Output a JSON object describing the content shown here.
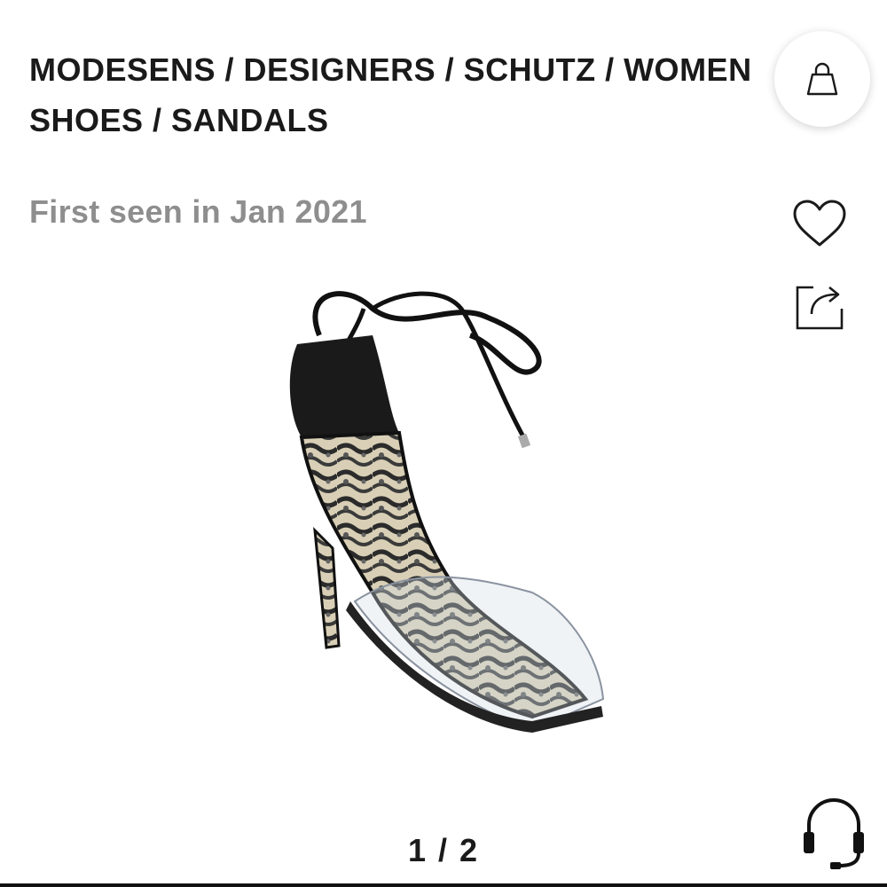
{
  "breadcrumb": {
    "line1": "MODESENS / DESIGNERS / SCHUTZ / WOMEN",
    "line2": "SHOES / SANDALS"
  },
  "product": {
    "first_seen": "First seen in Jan 2021",
    "image_alt": "Schutz clear vinyl snake print lace-up sandal"
  },
  "gallery": {
    "pager": "1 / 2"
  },
  "icons": {
    "cart": "shopping-bag-icon",
    "favorite": "heart-icon",
    "share": "share-icon",
    "support": "headset-icon"
  },
  "colors": {
    "text": "#1a1a1a",
    "muted": "#8e8e8e",
    "background": "#ffffff"
  }
}
